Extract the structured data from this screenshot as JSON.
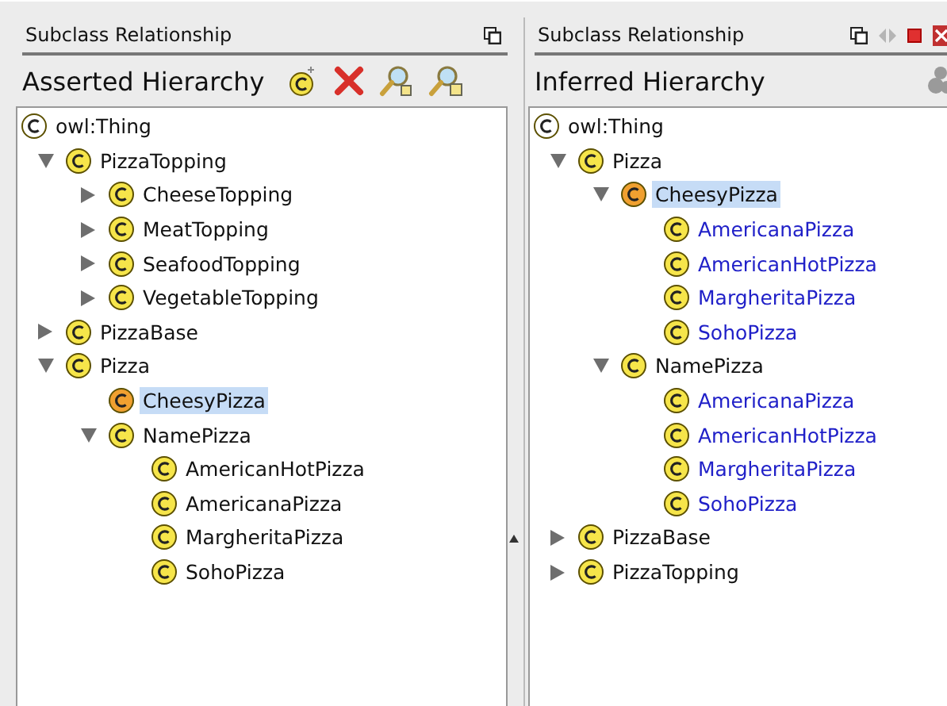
{
  "panels": [
    {
      "kind": "asserted",
      "header": "Subclass Relationship",
      "title": "Asserted Hierarchy",
      "tree": [
        {
          "label": "owl:Thing",
          "selected": false,
          "children": [
            {
              "label": "PizzaTopping",
              "selected": false,
              "expanded": true,
              "children": [
                {
                  "label": "CheeseTopping",
                  "selected": false,
                  "expanded": false
                },
                {
                  "label": "MeatTopping",
                  "selected": false,
                  "expanded": false
                },
                {
                  "label": "SeafoodTopping",
                  "selected": false,
                  "expanded": false
                },
                {
                  "label": "VegetableTopping",
                  "selected": false,
                  "expanded": false
                }
              ]
            },
            {
              "label": "PizzaBase",
              "selected": false,
              "expanded": false
            },
            {
              "label": "Pizza",
              "selected": false,
              "expanded": true,
              "children": [
                {
                  "label": "CheesyPizza",
                  "selected": true
                },
                {
                  "label": "NamePizza",
                  "selected": false,
                  "expanded": true,
                  "children": [
                    {
                      "label": "AmericanHotPizza",
                      "selected": false
                    },
                    {
                      "label": "AmericanaPizza",
                      "selected": false
                    },
                    {
                      "label": "MargheritaPizza",
                      "selected": false
                    },
                    {
                      "label": "SohoPizza",
                      "selected": false
                    }
                  ]
                }
              ]
            }
          ]
        }
      ]
    },
    {
      "kind": "inferred",
      "header": "Subclass Relationship",
      "title": "Inferred Hierarchy",
      "tree": [
        {
          "label": "owl:Thing",
          "selected": false,
          "inferred": false,
          "children": [
            {
              "label": "Pizza",
              "selected": false,
              "inferred": false,
              "expanded": true,
              "children": [
                {
                  "label": "CheesyPizza",
                  "selected": true,
                  "inferred": false,
                  "expanded": true,
                  "children": [
                    {
                      "label": "AmericanaPizza",
                      "selected": false,
                      "inferred": true
                    },
                    {
                      "label": "AmericanHotPizza",
                      "selected": false,
                      "inferred": true
                    },
                    {
                      "label": "MargheritaPizza",
                      "selected": false,
                      "inferred": true
                    },
                    {
                      "label": "SohoPizza",
                      "selected": false,
                      "inferred": true
                    }
                  ]
                },
                {
                  "label": "NamePizza",
                  "selected": false,
                  "inferred": false,
                  "expanded": true,
                  "children": [
                    {
                      "label": "AmericanaPizza",
                      "selected": false,
                      "inferred": true
                    },
                    {
                      "label": "AmericanHotPizza",
                      "selected": false,
                      "inferred": true
                    },
                    {
                      "label": "MargheritaPizza",
                      "selected": false,
                      "inferred": true
                    },
                    {
                      "label": "SohoPizza",
                      "selected": false,
                      "inferred": true
                    }
                  ]
                }
              ]
            },
            {
              "label": "PizzaBase",
              "selected": false,
              "inferred": false,
              "expanded": false
            },
            {
              "label": "PizzaTopping",
              "selected": false,
              "inferred": false,
              "expanded": false
            }
          ]
        }
      ]
    }
  ]
}
